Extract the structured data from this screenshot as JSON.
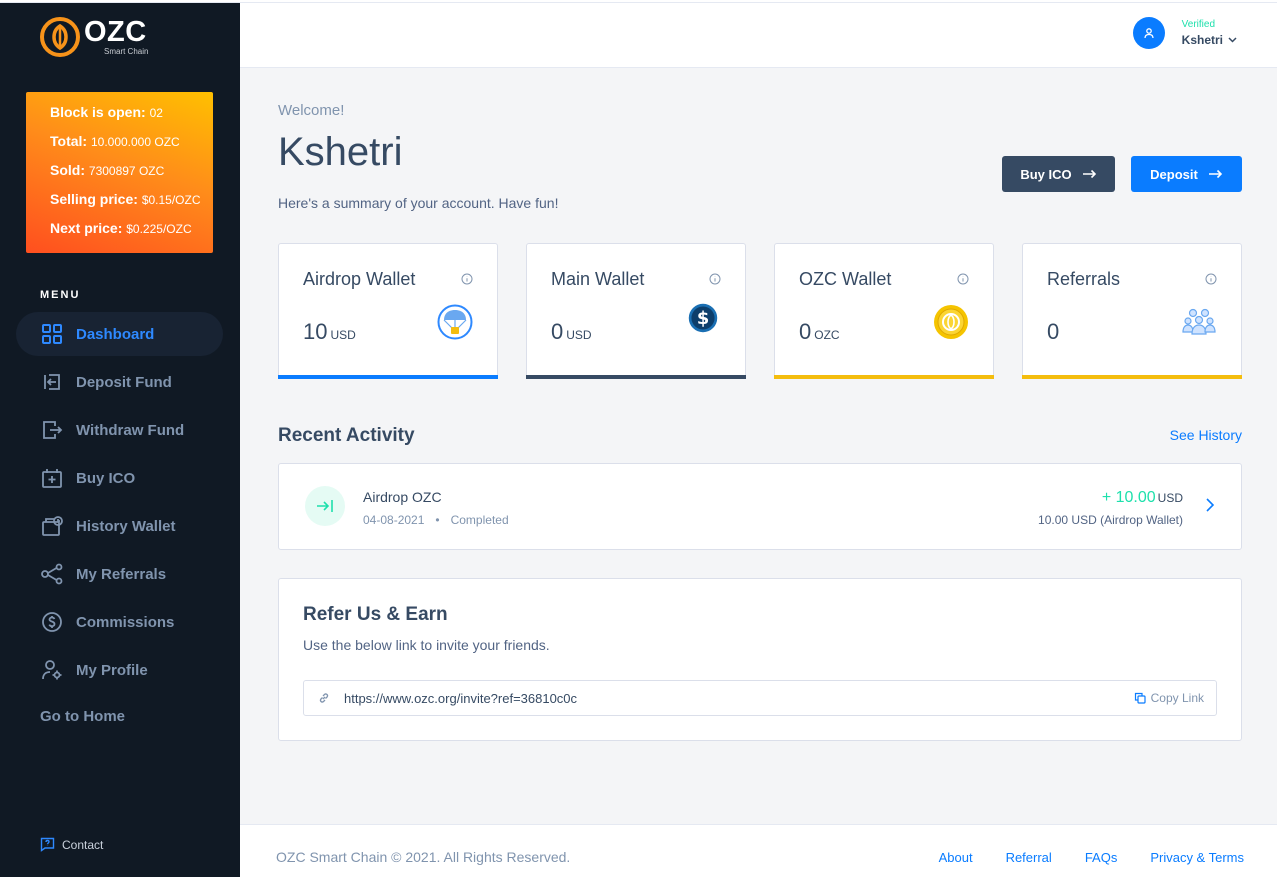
{
  "brand": {
    "name": "OZC",
    "tagline": "Smart Chain"
  },
  "promo": {
    "rows": [
      {
        "label": "Block is open:",
        "value": "02"
      },
      {
        "label": "Total:",
        "value": "10.000.000 OZC"
      },
      {
        "label": "Sold:",
        "value": "7300897 OZC"
      },
      {
        "label": "Selling price:",
        "value": "$0.15/OZC"
      },
      {
        "label": "Next price:",
        "value": "$0.225/OZC"
      }
    ]
  },
  "menu": {
    "title": "MENU",
    "items": [
      {
        "label": "Dashboard",
        "icon": "dashboard-icon",
        "active": true
      },
      {
        "label": "Deposit Fund",
        "icon": "deposit-icon"
      },
      {
        "label": "Withdraw Fund",
        "icon": "withdraw-icon"
      },
      {
        "label": "Buy ICO",
        "icon": "buy-ico-icon"
      },
      {
        "label": "History Wallet",
        "icon": "wallet-history-icon"
      },
      {
        "label": "My Referrals",
        "icon": "share-icon"
      },
      {
        "label": "Commissions",
        "icon": "dollar-circle-icon"
      },
      {
        "label": "My Profile",
        "icon": "user-gear-icon"
      }
    ],
    "go_home": "Go to Home",
    "contact": "Contact"
  },
  "header": {
    "user_status": "Verified",
    "user_name": "Kshetri"
  },
  "welcome": {
    "greeting": "Welcome!",
    "name": "Kshetri",
    "summary": "Here's a summary of your account. Have fun!"
  },
  "actions": {
    "buy_ico": "Buy ICO",
    "deposit": "Deposit"
  },
  "cards": [
    {
      "title": "Airdrop Wallet",
      "amount": "10",
      "unit": "USD",
      "color": "#0a7cff",
      "icon": "parachute-icon"
    },
    {
      "title": "Main Wallet",
      "amount": "0",
      "unit": "USD",
      "color": "#364a63",
      "icon": "dollar-coin-icon"
    },
    {
      "title": "OZC Wallet",
      "amount": "0",
      "unit": "OZC",
      "color": "#f4bd0e",
      "icon": "ozc-coin-icon"
    },
    {
      "title": "Referrals",
      "amount": "0",
      "unit": "",
      "color": "#f4bd0e",
      "icon": "users-group-icon"
    }
  ],
  "activity": {
    "title": "Recent Activity",
    "see_history": "See History",
    "items": [
      {
        "name": "Airdrop OZC",
        "date": "04-08-2021",
        "status": "Completed",
        "amount": "+ 10.00",
        "unit": "USD",
        "sub_amount": "10.00",
        "sub_text": "USD (Airdrop Wallet)"
      }
    ]
  },
  "refer": {
    "title": "Refer Us & Earn",
    "description": "Use the below link to invite your friends.",
    "url": "https://www.ozc.org/invite?ref=36810c0c",
    "copy_label": "Copy Link"
  },
  "footer": {
    "copyright": "OZC Smart Chain © 2021. All Rights Reserved.",
    "links": [
      "About",
      "Referral",
      "FAQs",
      "Privacy & Terms"
    ]
  }
}
